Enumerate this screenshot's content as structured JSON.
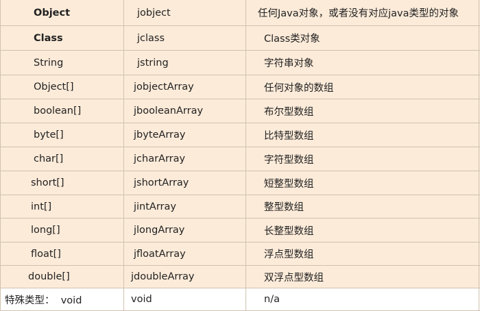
{
  "rows": [
    {
      "java": "Object",
      "jni": "jobject",
      "desc": "任何Java对象，或者没有对应java类型的对象",
      "bold": true
    },
    {
      "java": "Class",
      "jni": "jclass",
      "desc": "Class类对象",
      "bold": true
    },
    {
      "java": "String",
      "jni": "jstring",
      "desc": "字符串对象"
    },
    {
      "java": "Object[]",
      "jni": "jobjectArray",
      "desc": "任何对象的数组"
    },
    {
      "java": "boolean[]",
      "jni": "jbooleanArray",
      "desc": "布尔型数组"
    },
    {
      "java": "byte[]",
      "jni": "jbyteArray",
      "desc": "比特型数组"
    },
    {
      "java": "char[]",
      "jni": "jcharArray",
      "desc": "字符型数组"
    },
    {
      "java": "short[]",
      "jni": "jshortArray",
      "desc": "短整型数组"
    },
    {
      "java": "int[]",
      "jni": "jintArray",
      "desc": "整型数组"
    },
    {
      "java": "long[]",
      "jni": "jlongArray",
      "desc": "长整型数组"
    },
    {
      "java": "float[]",
      "jni": "jfloatArray",
      "desc": "浮点型数组"
    },
    {
      "java": "double[]",
      "jni": "jdoubleArray",
      "desc": "双浮点型数组"
    },
    {
      "java": "特殊类型：  void",
      "jni": "void",
      "desc": "n/a"
    }
  ],
  "colors": {
    "row_bg": "#fcebd9",
    "last_row_bg": "#ffffff",
    "border": "#cfc2ad"
  }
}
